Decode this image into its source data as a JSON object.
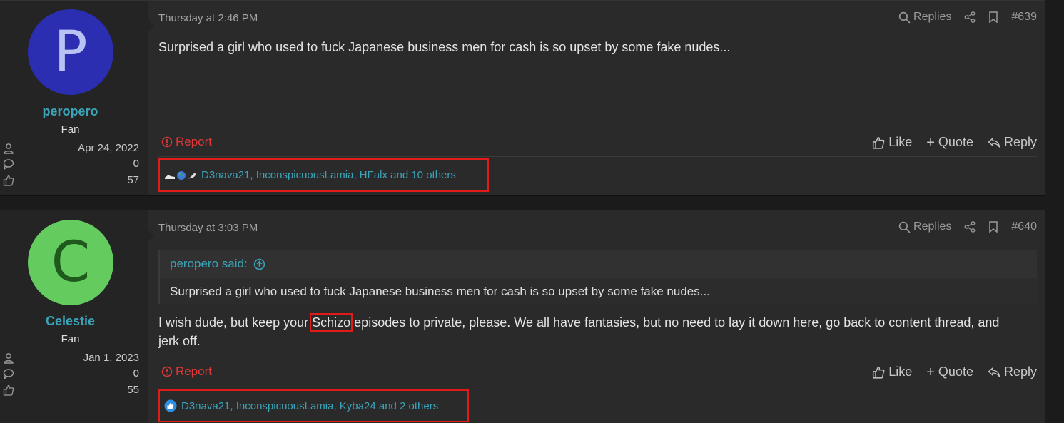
{
  "posts": [
    {
      "avatar_letter": "P",
      "username": "peropero",
      "user_title": "Fan",
      "joined": "Apr 24, 2022",
      "messages": "0",
      "reactions": "57",
      "date": "Thursday at 2:46 PM",
      "replies_label": "Replies",
      "post_number": "#639",
      "body": "Surprised a girl who used to fuck Japanese business men for cash is so upset by some fake nudes...",
      "report_label": "Report",
      "like_label": "Like",
      "quote_label": "Quote",
      "reply_label": "Reply",
      "reactions_text": "D3nava21, InconspicuousLamia, HFalx and 10 others"
    },
    {
      "avatar_letter": "C",
      "username": "Celestie",
      "user_title": "Fan",
      "joined": "Jan 1, 2023",
      "messages": "0",
      "reactions": "55",
      "date": "Thursday at 3:03 PM",
      "replies_label": "Replies",
      "post_number": "#640",
      "quote_author": "peropero said:",
      "quote_text": "Surprised a girl who used to fuck Japanese business men for cash is so upset by some fake nudes...",
      "body_before": "I wish dude, but keep your ",
      "body_highlight": "Schizo",
      "body_after": " episodes to private, please. We all have fantasies, but no need to lay it down here, go back to content thread, and",
      "body_line2": "jerk off.",
      "report_label": "Report",
      "like_label": "Like",
      "quote_label": "Quote",
      "reply_label": "Reply",
      "reactions_text": "D3nava21, InconspicuousLamia, Kyba24 and 2 others"
    }
  ],
  "colors": {
    "accent": "#3ba3b8",
    "report": "#e03838",
    "highlight_box": "#e11a1a",
    "avatar_p": "#2b2eb0",
    "avatar_c": "#64cc5f"
  }
}
